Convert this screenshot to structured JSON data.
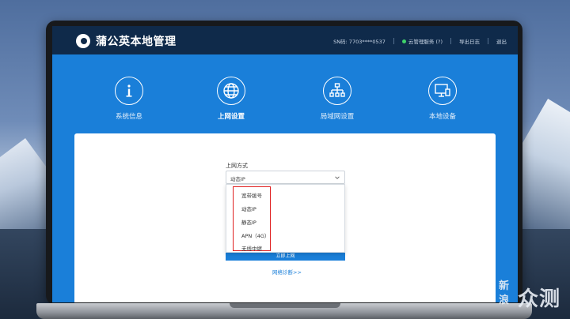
{
  "app": {
    "title": "蒲公英本地管理",
    "sn": "SN码: 7703****0537",
    "cloud_service": "云管理服务 (?)",
    "export_log": "导出日志",
    "logout": "退出"
  },
  "nav": {
    "items": [
      {
        "label": "系统信息",
        "icon": "info-icon"
      },
      {
        "label": "上网设置",
        "icon": "globe-icon"
      },
      {
        "label": "局域网设置",
        "icon": "network-tree-icon"
      },
      {
        "label": "本地设备",
        "icon": "monitor-icon"
      }
    ],
    "active": "上网设置"
  },
  "form": {
    "label": "上网方式",
    "selected": "动态IP",
    "options": [
      "宽带拨号",
      "动态IP",
      "静态IP",
      "APN（4G）",
      "无线中继"
    ],
    "submit_label": "立即上网",
    "diagnose_link": "网络诊断>>"
  },
  "watermark": {
    "small": "新浪",
    "big": "众测"
  },
  "colors": {
    "topbar": "#0f2a4a",
    "primary": "#1a7fd9",
    "highlight": "#e02020",
    "status_online": "#3fd26a"
  }
}
